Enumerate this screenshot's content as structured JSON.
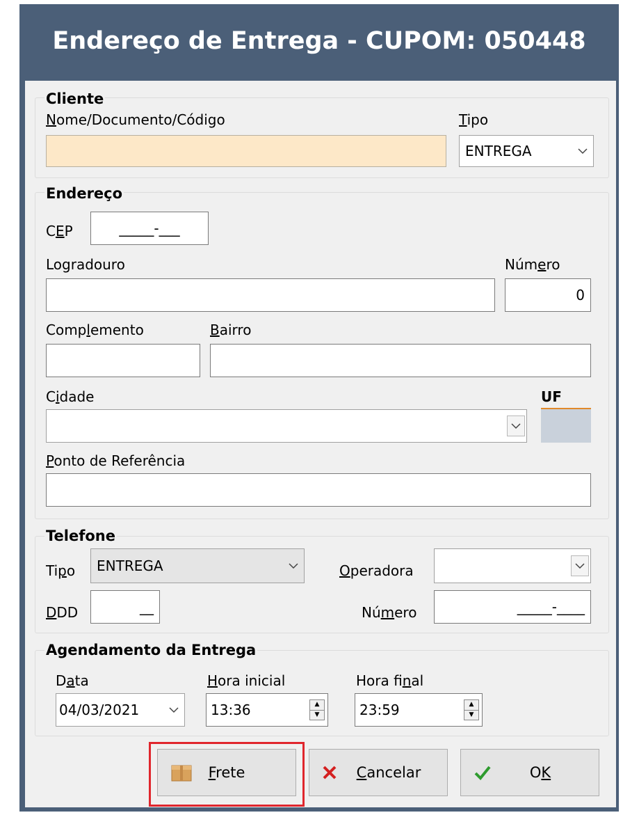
{
  "window": {
    "title": "Endereço de Entrega - CUPOM: 050448"
  },
  "cliente": {
    "group_label": "Cliente",
    "nome_label": "Nome/Documento/Código",
    "nome_value": "",
    "tipo_label": "Tipo",
    "tipo_value": "ENTREGA"
  },
  "endereco": {
    "group_label": "Endereço",
    "cep_label": "CEP",
    "cep_value": "_____-___",
    "logradouro_label": "Logradouro",
    "logradouro_value": "",
    "numero_label": "Número",
    "numero_value": "0",
    "complemento_label": "Complemento",
    "complemento_value": "",
    "bairro_label": "Bairro",
    "bairro_value": "",
    "cidade_label": "Cidade",
    "cidade_value": "",
    "uf_label": "UF",
    "uf_value": "",
    "referencia_label": "Ponto de Referência",
    "referencia_value": ""
  },
  "telefone": {
    "group_label": "Telefone",
    "tipo_label": "Tipo",
    "tipo_value": "ENTREGA",
    "operadora_label": "Operadora",
    "operadora_value": "",
    "ddd_label": "DDD",
    "ddd_value": "__",
    "numero_label": "Número",
    "numero_value": "_____-____"
  },
  "agendamento": {
    "group_label": "Agendamento da Entrega",
    "data_label": "Data",
    "data_value": "04/03/2021",
    "hora_inicial_label": "Hora inicial",
    "hora_inicial_value": "13:36",
    "hora_final_label": "Hora final",
    "hora_final_value": "23:59"
  },
  "buttons": {
    "frete": "Frete",
    "cancelar": "Cancelar",
    "ok": "OK"
  },
  "colors": {
    "title_bar": "#4b5f78",
    "highlight": "#e0262d",
    "ok_check": "#2e9b2e",
    "cancel_x": "#d42020",
    "required_field": "#fde8c8"
  },
  "icons": {
    "frete": "package-icon",
    "cancelar": "close-icon",
    "ok": "checkmark-icon"
  }
}
